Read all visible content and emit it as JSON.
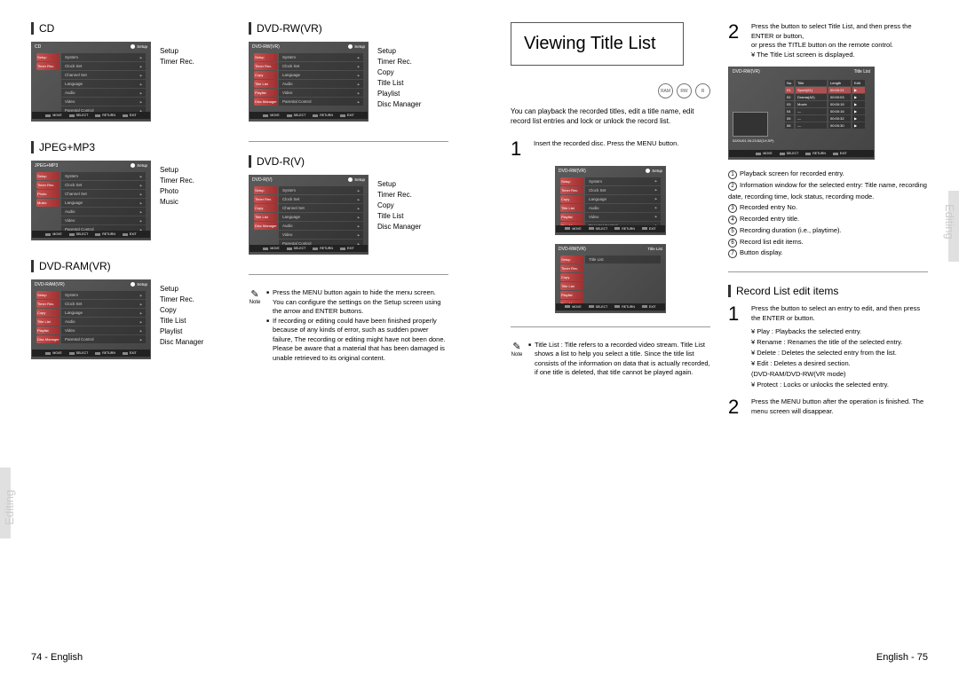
{
  "headings": {
    "cd": "CD",
    "jpegmp3": "JPEG+MP3",
    "dvdram": "DVD-RAM(VR)",
    "dvdrwvr": "DVD-RW(VR)",
    "dvdrv": "DVD-R(V)",
    "record_list": "Record List edit items"
  },
  "title": "Viewing Title List",
  "tab_left": "Editing",
  "tab_right": "Editing",
  "page_left": "74 - English",
  "page_right": "English - 75",
  "scr_setup_label": "Setup",
  "scr_titlelist_label": "Title List",
  "footer": {
    "move": "MOVE",
    "select": "SELECT",
    "return": "RETURN",
    "exit": "EXIT"
  },
  "menu_items": {
    "system": "System",
    "clockset": "Clock Set",
    "channelset": "Channel Set",
    "language": "Language",
    "audio": "Audio",
    "video": "Video",
    "parental": "Parental Control",
    "title_list": "Title List"
  },
  "icon_labels": {
    "setup": "Setup",
    "timer": "Timer Rec.",
    "copy": "Copy",
    "titlelist": "Title List",
    "playlist": "Playlist",
    "discman": "Disc Manager",
    "photo": "Photo",
    "music": "Music"
  },
  "scr_titles": {
    "cd": "CD",
    "jpegmp3": "JPEG+MP3",
    "dvdram": "DVD-RAM(VR)",
    "dvdrwvr": "DVD-RW(VR)",
    "dvdrv": "DVD-R(V)",
    "dvdrwvr2": "DVD-RW(VR)"
  },
  "side_lists": {
    "cd": [
      "Setup",
      "Timer Rec."
    ],
    "jpegmp3": [
      "Setup",
      "Timer Rec.",
      "Photo",
      "Music"
    ],
    "dvdram": [
      "Setup",
      "Timer Rec.",
      "Copy",
      "Title List",
      "Playlist",
      "Disc Manager"
    ],
    "dvdrwvr": [
      "Setup",
      "Timer Rec.",
      "Copy",
      "Title List",
      "Playlist",
      "Disc Manager"
    ],
    "dvdrv": [
      "Setup",
      "Timer Rec.",
      "Copy",
      "Title List",
      "Disc Manager"
    ]
  },
  "intro_text": "You can playback the recorded titles, edit a title name, edit record list entries and lock or unlock the record list.",
  "step1_text": "Insert the recorded disc.\nPress the MENU button.",
  "note1_a": "Press the MENU button again to hide the menu screen. You can configure the settings on the Setup screen using the arrow and ENTER buttons.",
  "note1_b": "If recording or editing could have been finished properly because of any kinds of error, such as sudden power failure, The recording or editing might have not been done. Please be aware that a material that has been damaged is unable retrieved to its original content.",
  "note2_text": "Title List : Title refers to a recorded video stream. Title List shows a list to help you select a title. Since the title list consists of the information on data that is actually recorded, if one title is deleted, that title cannot be played again.",
  "note_label": "Note",
  "step2a_text": "Press the     button to select Title List, and then press the ENTER or    button,",
  "step2a_sub1": "or press the TITLE button on the remote control.",
  "step2a_sub2": "¥ The Title List screen is displayed.",
  "title_list": {
    "headers": [
      "No.",
      "Title",
      "Length",
      "Edit"
    ],
    "rows": [
      {
        "no": "01",
        "title": "Sport(A1)",
        "len": "00:00:21",
        "edit": "▶"
      },
      {
        "no": "02",
        "title": "Drama(A2)",
        "len": "00:00:03",
        "edit": "▶"
      },
      {
        "no": "03",
        "title": "Movie",
        "len": "00:00:15",
        "edit": "▶"
      },
      {
        "no": "04",
        "title": "—",
        "len": "00:00:16",
        "edit": "▶"
      },
      {
        "no": "05",
        "title": "—",
        "len": "00:00:32",
        "edit": "▶"
      },
      {
        "no": "06",
        "title": "—",
        "len": "00:00:30",
        "edit": "▶"
      }
    ],
    "date": "02/01/01\n00:23:52(1H,SP)"
  },
  "annotations": [
    "Playback screen for recorded entry.",
    "Information window for the selected entry: Title name, recording date, recording time, lock status, recording mode.",
    "Recorded entry No.",
    "Recorded entry title.",
    "Recording duration (i.e., playtime).",
    "Record list edit items.",
    "Button display."
  ],
  "record_step1": "Press the     button to select an entry to edit, and then press the ENTER or    button.",
  "record_yen": [
    "¥ Play : Playbacks the selected entry.",
    "¥ Rename : Renames the title of the selected entry.",
    "¥ Delete : Deletes the selected entry from the list.",
    "¥ Edit : Deletes a desired section.",
    "           (DVD-RAM/DVD-RW(VR mode)",
    "¥ Protect : Locks or unlocks the selected entry."
  ],
  "record_step2": "Press the MENU button after the operation is finished. The menu screen will disappear.",
  "disc_labels": [
    "RAM",
    "RW",
    "R"
  ]
}
